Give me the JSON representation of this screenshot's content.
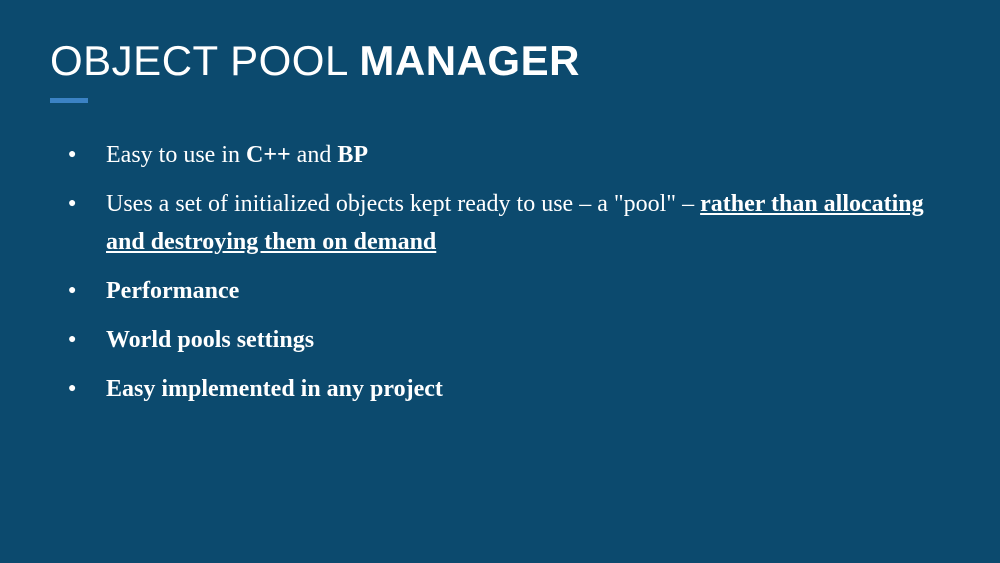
{
  "title": {
    "light": "OBJECT POOL ",
    "bold": "MANAGER"
  },
  "bullets": {
    "b1": {
      "t1": "Easy to use in ",
      "t2": "C++",
      "t3": " and ",
      "t4": "BP"
    },
    "b2": {
      "t1": "Uses a set of initialized objects kept ready to use – a \"pool\" – ",
      "t2": "rather than allocating and destroying them on demand"
    },
    "b3": {
      "t1": "Performance"
    },
    "b4": {
      "t1": "World pools settings"
    },
    "b5": {
      "t1": "Easy implemented in any project"
    }
  }
}
